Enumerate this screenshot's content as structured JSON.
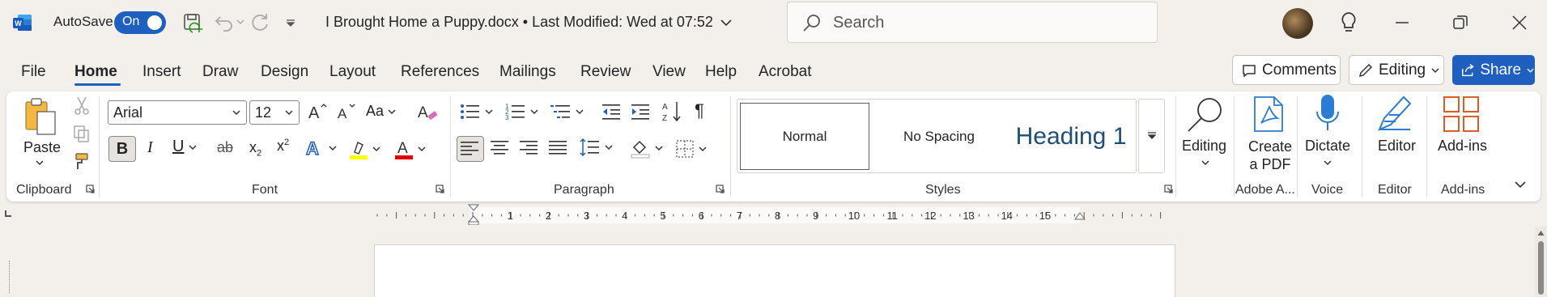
{
  "titlebar": {
    "app_icon": "word-icon",
    "autosave_label": "AutoSave",
    "autosave_state": "On",
    "doc_title": "I Brought Home a Puppy.docx • Last Modified: Wed at 07:52",
    "search_placeholder": "Search"
  },
  "tabs": [
    "File",
    "Home",
    "Insert",
    "Draw",
    "Design",
    "Layout",
    "References",
    "Mailings",
    "Review",
    "View",
    "Help",
    "Acrobat"
  ],
  "active_tab": "Home",
  "right_buttons": {
    "comments": "Comments",
    "editing": "Editing",
    "share": "Share"
  },
  "ribbon": {
    "clipboard": {
      "paste": "Paste",
      "label": "Clipboard"
    },
    "font": {
      "family": "Arial",
      "size": "12",
      "change_case": "Aa",
      "label": "Font"
    },
    "paragraph": {
      "label": "Paragraph"
    },
    "styles": {
      "items": [
        "Normal",
        "No Spacing",
        "Heading 1"
      ],
      "label": "Styles"
    },
    "editing": {
      "label": "Editing"
    },
    "adobe": {
      "button": "Create a PDF",
      "button_line1": "Create",
      "button_line2": "a PDF",
      "label": "Adobe A..."
    },
    "voice": {
      "button": "Dictate",
      "label": "Voice"
    },
    "editor": {
      "button": "Editor",
      "label": "Editor"
    },
    "addins": {
      "button": "Add-ins",
      "label": "Add-ins"
    }
  },
  "ruler": {
    "numbers": [
      "1",
      "2",
      "3",
      "4",
      "5",
      "6",
      "7",
      "8",
      "9",
      "10",
      "11",
      "12",
      "13",
      "14",
      "15"
    ]
  },
  "colors": {
    "accent": "#1f5fbf",
    "highlight": "#ffff00",
    "font_color": "#e00000",
    "heading": "#1f4e79"
  }
}
